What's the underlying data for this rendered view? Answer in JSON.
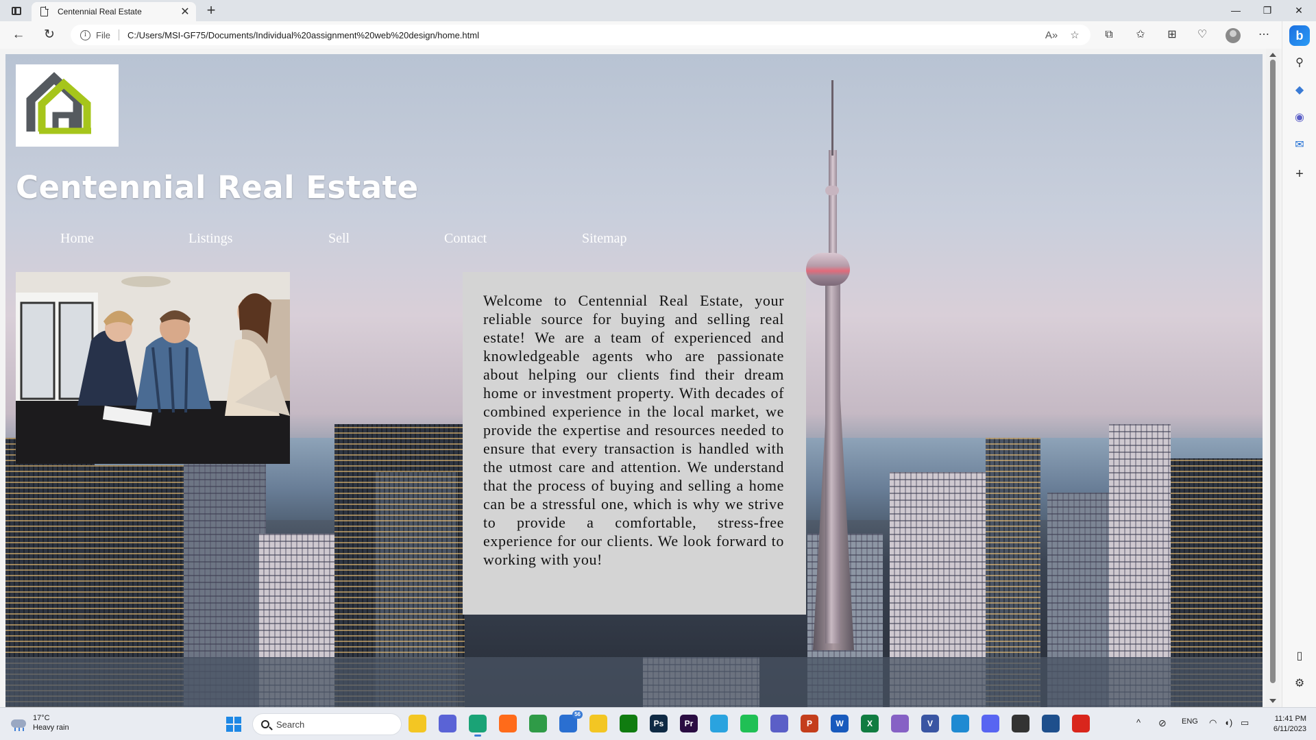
{
  "browser": {
    "tab_title": "Centennial Real Estate",
    "tab_close": "✕",
    "new_tab": "+",
    "address_scheme": "File",
    "address_url": "C:/Users/MSI-GF75/Documents/Individual%20assignment%20web%20design/home.html",
    "window_controls": {
      "minimize": "—",
      "restore": "❐",
      "close": "✕"
    },
    "nav": {
      "back": "←",
      "reload": "↻"
    },
    "toolbar_icons": [
      "read-aloud-icon",
      "favorite-star-icon",
      "extensions-icon",
      "favorites-icon",
      "collections-icon",
      "browser-essentials-icon",
      "profile-avatar-icon",
      "more-menu-icon"
    ],
    "toolbar_glyphs": {
      "read_aloud": "A»",
      "favorite": "☆",
      "extensions": "⧉",
      "favorites": "✩",
      "collections": "⊞",
      "essentials": "♡",
      "more": "⋯"
    },
    "sidebar_glyphs": {
      "bing": "b",
      "search": "⚲",
      "shopping": "◆",
      "office": "◉",
      "outlook": "✉",
      "add": "+",
      "split": "▯",
      "settings": "⚙"
    }
  },
  "page": {
    "site_title": "Centennial Real Estate",
    "nav_links": [
      "Home",
      "Listings",
      "Sell",
      "Contact",
      "Sitemap"
    ],
    "welcome_text": "Welcome to Centennial Real Estate, your reliable source for buying and selling real estate! We are a team of experienced and knowledgeable agents who are passionate about helping our clients find their dream home or investment property. With decades of combined experience in the local market, we provide the expertise and resources needed to ensure that every transaction is handled with the utmost care and attention. We understand that the process of buying and selling a home can be a stressful one, which is why we strive to provide a comfortable, stress-free experience for our clients. We look forward to working with you!",
    "colors": {
      "logo_dark": "#555a5f",
      "logo_green": "#a6c51b",
      "welcome_bg": "#d4d4d4"
    }
  },
  "taskbar": {
    "weather_temp": "17°C",
    "weather_desc": "Heavy rain",
    "search_placeholder": "Search",
    "mail_badge": "56",
    "apps": [
      {
        "name": "file-explorer-icon",
        "label": "",
        "color": "#f3c623"
      },
      {
        "name": "meet-icon",
        "label": "",
        "color": "#5a63d6"
      },
      {
        "name": "edge-icon",
        "label": "",
        "color": "#1aa376"
      },
      {
        "name": "firefox-icon",
        "label": "",
        "color": "#ff6b1a"
      },
      {
        "name": "chrome-icon",
        "label": "",
        "color": "#2f9b47"
      },
      {
        "name": "mail-icon",
        "label": "",
        "color": "#2a6fd1"
      },
      {
        "name": "folder-icon",
        "label": "",
        "color": "#f3c623"
      },
      {
        "name": "xbox-icon",
        "label": "",
        "color": "#107c10"
      },
      {
        "name": "photoshop-icon",
        "label": "Ps",
        "color": "#0f2a44"
      },
      {
        "name": "premiere-icon",
        "label": "Pr",
        "color": "#2a0c42"
      },
      {
        "name": "telegram-icon",
        "label": "",
        "color": "#2aa3df"
      },
      {
        "name": "line-icon",
        "label": "",
        "color": "#20c055"
      },
      {
        "name": "teams-icon",
        "label": "",
        "color": "#5b5fc7"
      },
      {
        "name": "powerpoint-icon",
        "label": "P",
        "color": "#c43e1c"
      },
      {
        "name": "word-icon",
        "label": "W",
        "color": "#185abd"
      },
      {
        "name": "excel-icon",
        "label": "X",
        "color": "#107c41"
      },
      {
        "name": "visual-studio-icon",
        "label": "",
        "color": "#8661c5"
      },
      {
        "name": "visio-icon",
        "label": "V",
        "color": "#3955a3"
      },
      {
        "name": "vscode-icon",
        "label": "",
        "color": "#1f8ad2"
      },
      {
        "name": "discord-icon",
        "label": "",
        "color": "#5865f2"
      },
      {
        "name": "unity-icon",
        "label": "",
        "color": "#333333"
      },
      {
        "name": "virtualbox-icon",
        "label": "",
        "color": "#1e4f8c"
      },
      {
        "name": "acrobat-icon",
        "label": "",
        "color": "#d9261c"
      }
    ],
    "tray": {
      "chevron": "^",
      "lang": "ENG",
      "time": "11:41 PM",
      "date": "6/11/2023"
    }
  }
}
